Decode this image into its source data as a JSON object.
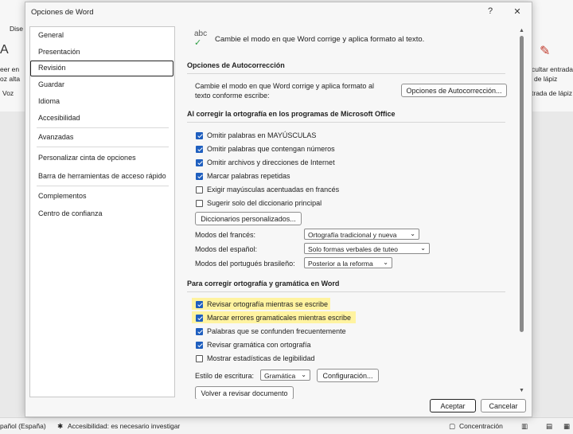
{
  "background": {
    "ribbon_left_top": "Dise",
    "ribbon_left_1": "eer en",
    "ribbon_left_2": "oz alta",
    "ribbon_left_3": "Voz",
    "ribbon_right_1": "cultar entrada",
    "ribbon_right_2": "de lápiz",
    "ribbon_right_3": "trada de lápiz",
    "status_language": "pañol (España)",
    "status_accessibility": "Accesibilidad: es necesario investigar",
    "status_focus": "Concentración"
  },
  "dialog": {
    "title": "Opciones de Word",
    "help": "?",
    "close": "✕",
    "nav": [
      "General",
      "Presentación",
      "Revisión",
      "Guardar",
      "Idioma",
      "Accesibilidad",
      "Avanzadas",
      "Personalizar cinta de opciones",
      "Barra de herramientas de acceso rápido",
      "Complementos",
      "Centro de confianza"
    ],
    "selected_nav": "Revisión",
    "intro_icon_text": "abc",
    "intro": "Cambie el modo en que Word corrige y aplica formato al texto.",
    "autocorrect": {
      "header": "Opciones de Autocorrección",
      "desc_1": "Cambie el modo en que Word corrige y aplica formato al",
      "desc_2": "texto conforme escribe:",
      "button": "Opciones de Autocorrección..."
    },
    "office_spelling": {
      "header": "Al corregir la ortografía en los programas de Microsoft Office",
      "checks": [
        {
          "label": "Omitir palabras en MAYÚSCULAS",
          "checked": true
        },
        {
          "label": "Omitir palabras que contengan números",
          "checked": true
        },
        {
          "label": "Omitir archivos y direcciones de Internet",
          "checked": true
        },
        {
          "label": "Marcar palabras repetidas",
          "checked": true
        },
        {
          "label": "Exigir mayúsculas acentuadas en francés",
          "checked": false
        },
        {
          "label": "Sugerir solo del diccionario principal",
          "checked": false
        }
      ],
      "dict_button": "Diccionarios personalizados...",
      "modes": [
        {
          "label": "Modos del francés:",
          "value": "Ortografía tradicional y nueva"
        },
        {
          "label": "Modos del español:",
          "value": "Solo formas verbales de tuteo"
        },
        {
          "label": "Modos del portugués brasileño:",
          "value": "Posterior a la reforma"
        }
      ]
    },
    "word_spelling": {
      "header": "Para corregir ortografía y gramática en Word",
      "checks": [
        {
          "label": "Revisar ortografía mientras se escribe",
          "checked": true
        },
        {
          "label": "Marcar errores gramaticales mientras escribe",
          "checked": true
        },
        {
          "label": "Palabras que se confunden frecuentemente",
          "checked": true
        },
        {
          "label": "Revisar gramática con ortografía",
          "checked": true
        },
        {
          "label": "Mostrar estadísticas de legibilidad",
          "checked": false
        }
      ],
      "style_label": "Estilo de escritura:",
      "style_value": "Gramática",
      "config_button": "Configuración...",
      "recheck_button": "Volver a revisar documento"
    },
    "ok": "Aceptar",
    "cancel": "Cancelar"
  }
}
